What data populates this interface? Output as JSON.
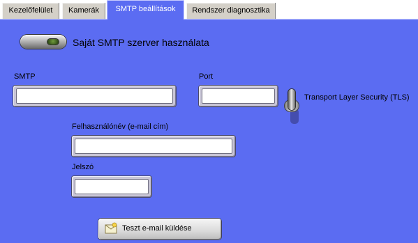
{
  "tabs": [
    {
      "label": "Kezelőfelület",
      "active": false
    },
    {
      "label": "Kamerák",
      "active": false
    },
    {
      "label": "SMTP beállítások",
      "active": true
    },
    {
      "label": "Rendszer diagnosztika",
      "active": false
    }
  ],
  "smtp": {
    "own_server_label": "Saját SMTP szerver használata",
    "own_server_switch_on": false,
    "smtp_label": "SMTP",
    "smtp_value": "",
    "port_label": "Port",
    "port_value": "",
    "tls_label": "Transport Layer Security (TLS)",
    "username_label": "Felhasználónév (e-mail cím)",
    "username_value": "",
    "password_label": "Jelszó",
    "password_value": "",
    "test_button_label": "Teszt e-mail küldése",
    "test_button_icon": "envelope-icon"
  },
  "colors": {
    "panel_background": "#5b6cf2",
    "tab_inactive": "#d4d0c8",
    "led_green": "#4f7a28"
  }
}
